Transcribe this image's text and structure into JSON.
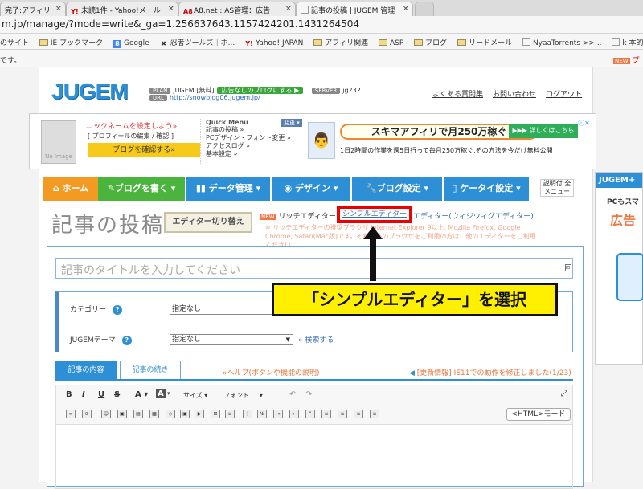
{
  "browser": {
    "tabs": [
      {
        "label": "完了:アフィリ",
        "active": false
      },
      {
        "label": "未読1件 - Yahoo!メール",
        "active": false
      },
      {
        "label": "A8.net : AS管理：広告",
        "active": false
      },
      {
        "label": "記事の投稿 | JUGEM 管理",
        "active": true
      }
    ],
    "address": "m.jp/manage/?mode=write&_ga=1.256637643.1157424201.1431264504",
    "bookmarks": [
      {
        "label": "のサイト",
        "folder": false
      },
      {
        "label": "IE ブックマーク",
        "folder": true
      },
      {
        "label": "Google",
        "folder": false
      },
      {
        "label": "忍者ツールズ｜ホ...",
        "folder": false
      },
      {
        "label": "Yahoo! JAPAN",
        "folder": false
      },
      {
        "label": "アフィリ関連",
        "folder": true
      },
      {
        "label": "ASP",
        "folder": true
      },
      {
        "label": "ブログ",
        "folder": true
      },
      {
        "label": "リードメール",
        "folder": true
      },
      {
        "label": "NyaaTorrents >>...",
        "folder": false
      },
      {
        "label": "k 本的に",
        "folder": false
      }
    ],
    "infobar_left": "です。",
    "infobar_right": "プラ"
  },
  "header": {
    "logo": "JUGEM",
    "plan_tag": "PLAN",
    "plan": "JUGEM [無料]",
    "ad_free_button": "広告なしのブログにする ▶",
    "server_tag": "SERVER",
    "server": "jg232",
    "url_tag": "URL",
    "url": "http://snowblog06.jugem.jp/",
    "links": [
      "よくある質問集",
      "お問い合わせ",
      "ログアウト"
    ]
  },
  "profile": {
    "no_image": "No Image",
    "nickname_prompt": "ニックネームを設定しよう»",
    "profile_edit": "[ プロフィールの編集 / 確認 ]",
    "check_blog": "ブログを確認する»"
  },
  "quick_menu": {
    "title": "Quick Menu",
    "change": "変更 ▾",
    "items": [
      "記事の投稿 »",
      "PCデザイン・フォント変更 »",
      "アクセスログ »",
      "基本設定 »"
    ]
  },
  "ad": {
    "headline": "スキマアフィリで月250万稼ぐ",
    "button": "▶▶▶ 詳しくはこちら",
    "sub": "1日2時間の作業を週5日行って毎月250万稼ぐ,その方法を今だけ無料公開"
  },
  "nav": {
    "home": "ホーム",
    "write": "ブログを書く ▾",
    "data": "データ管理 ▾",
    "design": "デザイン ▾",
    "settings": "ブログ設定 ▾",
    "mobile": "ケータイ設定 ▾",
    "help": "説明付 全メニュー"
  },
  "editor": {
    "page_title": "記事の投稿",
    "switch_button": "エディター切り替え",
    "new_badge": "NEW",
    "rich": "リッチエディター",
    "simple": "シンプルエディター",
    "wysiwyg": "エディター(ウィジウィグエディター)",
    "note": "※ リッチエディターの推奨ブラウザ Internet Explorer 9以上, Mozilla Firefox, Google Chrome, Safari(Mac版)です。それ以外のブラウザをご利用の方は、他のエディターをご利用ください。",
    "callout": "「シンプルエディター」を選択"
  },
  "form": {
    "title_placeholder": "記事のタイトルを入力してください",
    "category_label": "カテゴリー",
    "category_value": "指定なし",
    "theme_label": "JUGEMテーマ",
    "theme_value": "指定なし",
    "search": "» 検索する",
    "tab_content": "記事の内容",
    "tab_continue": "記事の続き",
    "help_link": "»ヘルプ(ボタンや機能の説明)",
    "update": "[更新情報] IE11での動作を修正しました(1/23)",
    "size": "サイズ",
    "font": "フォント",
    "html_mode": "<HTML>モード"
  },
  "side": {
    "brand": "JUGEM+",
    "line1": "PCもスマ",
    "line2": "広告"
  },
  "colors": {
    "home": "#f39a23",
    "write": "#4bb43d",
    "data": "#2d8fd5",
    "design": "#2d8fd5",
    "settings": "#2d8fd5",
    "mobile": "#2d8fd5"
  }
}
